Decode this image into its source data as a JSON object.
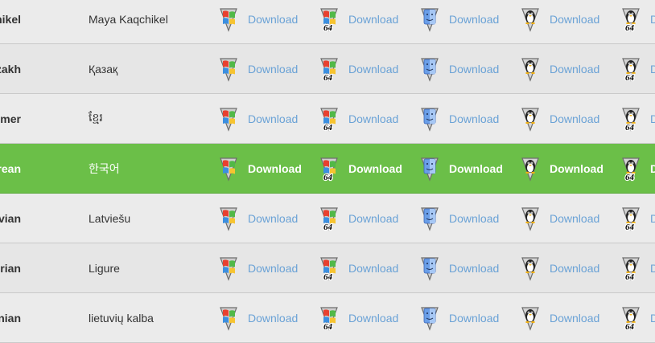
{
  "columns": [
    {
      "icon": "windows-icon"
    },
    {
      "icon": "windows-64-icon",
      "badge": "64"
    },
    {
      "icon": "mac-icon"
    },
    {
      "icon": "linux-icon"
    },
    {
      "icon": "linux-64-icon",
      "badge": "64"
    }
  ],
  "download_label": "Download",
  "last_column_label": "D",
  "rows": [
    {
      "english": "Kaqchikel",
      "native": "Maya Kaqchikel",
      "highlighted": false
    },
    {
      "english": "Kazakh",
      "native": "Қазақ",
      "highlighted": false
    },
    {
      "english": "Khmer",
      "native": "ខ្មែរ",
      "highlighted": false
    },
    {
      "english": "Korean",
      "native": "한국어",
      "highlighted": true
    },
    {
      "english": "Latvian",
      "native": "Latviešu",
      "highlighted": false
    },
    {
      "english": "Ligurian",
      "native": "Ligure",
      "highlighted": false
    },
    {
      "english": "Lithuanian",
      "native": "lietuvių kalba",
      "highlighted": false
    }
  ],
  "colors": {
    "link": "#6aa2d6",
    "highlight_row": "#6bbf48",
    "row_bg": "#ebebeb",
    "divider": "#c9c9c9"
  }
}
